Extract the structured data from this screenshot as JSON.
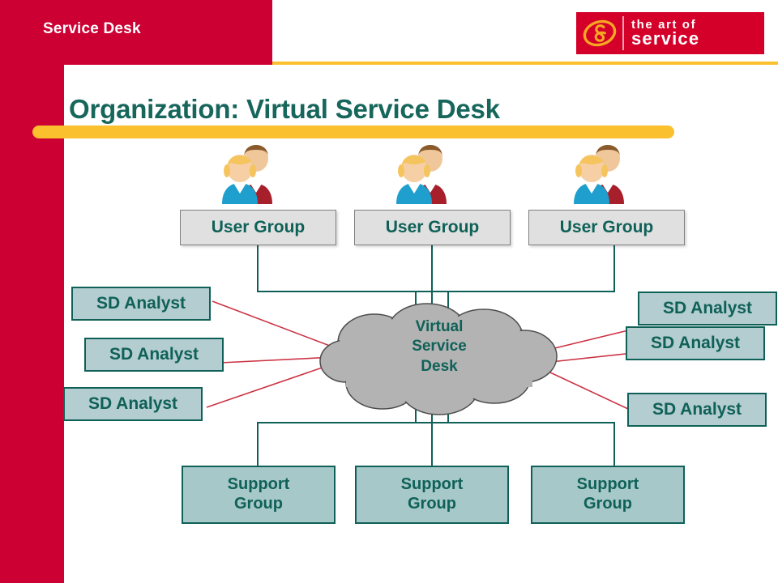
{
  "header": {
    "title": "Service Desk",
    "brand_red": "#cc0033",
    "accent_yellow": "#fbc02d"
  },
  "logo": {
    "name": "the-art-of-service-logo",
    "line1": "the art of",
    "line2": "service",
    "mark": "ampersand-swirl-icon",
    "background": "#d4002a",
    "mark_color": "#f5a623"
  },
  "slide": {
    "title": "Organization: Virtual Service Desk",
    "title_color": "#17665c"
  },
  "diagram": {
    "type": "org-chart",
    "center": {
      "label_lines": [
        "Virtual",
        "Service",
        "Desk"
      ],
      "shape": "cloud",
      "fill": "#b3b3b3",
      "stroke": "#4d4d4d"
    },
    "user_groups": [
      {
        "label": "User Group",
        "icon": "two-people-icon"
      },
      {
        "label": "User Group",
        "icon": "two-people-icon"
      },
      {
        "label": "User Group",
        "icon": "two-people-icon"
      }
    ],
    "analysts_left": [
      {
        "label": "SD Analyst"
      },
      {
        "label": "SD Analyst"
      },
      {
        "label": "SD Analyst"
      }
    ],
    "analysts_right": [
      {
        "label": "SD Analyst"
      },
      {
        "label": "SD Analyst"
      },
      {
        "label": "SD Analyst"
      }
    ],
    "support_groups": [
      {
        "line1": "Support",
        "line2": "Group"
      },
      {
        "line1": "Support",
        "line2": "Group"
      },
      {
        "line1": "Support",
        "line2": "Group"
      }
    ],
    "connector_colors": {
      "tree": "#0f6158",
      "analyst": "#cc3344"
    },
    "node_colors": {
      "user_group_fill": "#e0e0e0",
      "user_group_border": "#808080",
      "analyst_fill": "#b4cdd0",
      "support_fill": "#a7c8c9",
      "node_border": "#0f6158",
      "text": "#0f6158"
    }
  }
}
